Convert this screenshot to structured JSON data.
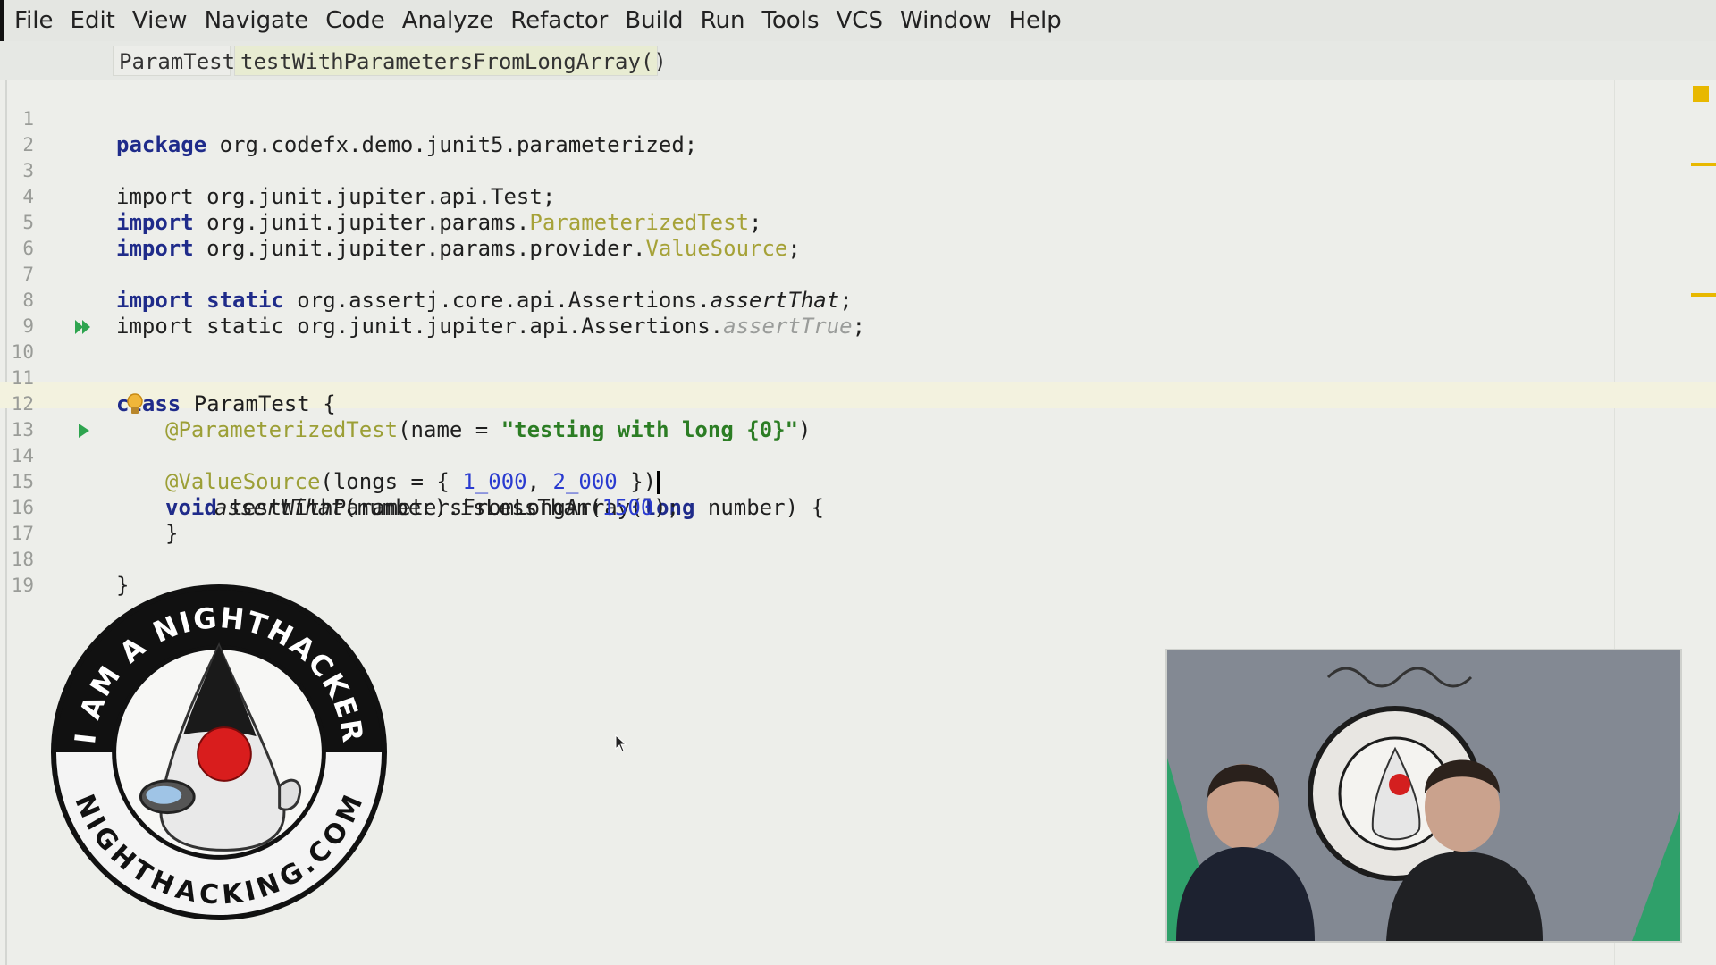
{
  "menubar": {
    "items": [
      "File",
      "Edit",
      "View",
      "Navigate",
      "Code",
      "Analyze",
      "Refactor",
      "Build",
      "Run",
      "Tools",
      "VCS",
      "Window",
      "Help"
    ]
  },
  "breadcrumbs": {
    "class_name": "ParamTest",
    "method_name": "testWithParametersFromLongArray()"
  },
  "editor": {
    "line_numbers": [
      "1",
      "2",
      "3",
      "4",
      "5",
      "6",
      "7",
      "8",
      "9",
      "10",
      "11",
      "12",
      "13",
      "14",
      "15",
      "16",
      "17",
      "18",
      "19"
    ],
    "code": {
      "l1": {
        "kw": "package",
        "rest": " org.codefx.demo.junit5.parameterized;"
      },
      "l3": {
        "text": "import org.junit.jupiter.api.Test;"
      },
      "l4": {
        "kw": "import",
        "pkg": " org.junit.jupiter.params.",
        "cls": "ParameterizedTest",
        "end": ";"
      },
      "l5": {
        "kw": "import",
        "pkg": " org.junit.jupiter.params.provider.",
        "cls": "ValueSource",
        "end": ";"
      },
      "l7": {
        "kw1": "import",
        "kw2": "static",
        "pkg": " org.assertj.core.api.Assertions.",
        "method": "assertThat",
        "end": ";"
      },
      "l8": {
        "kw1": "import",
        "kw2": "static",
        "pkg": " org.junit.jupiter.api.Assertions.",
        "method": "assertTrue",
        "end": ";"
      },
      "l10": {
        "kw": "class",
        "rest": " ParamTest {"
      },
      "l12": {
        "ann": "@ParameterizedTest",
        "open": "(name = ",
        "str": "\"testing with long {0}\"",
        "close": ")"
      },
      "l13": {
        "ann": "@ValueSource",
        "open": "(longs = { ",
        "n1": "1_000",
        "sep": ", ",
        "n2": "2_000",
        "close": " })"
      },
      "l14": {
        "kw": "void",
        "name": " testWithParametersFromLongArray(",
        "kw2": "long",
        "rest": " number) {"
      },
      "l15": {
        "method": "assertThat",
        "mid": "(number).isLessThan(",
        "num": "1500",
        "end": ");"
      },
      "l16": {
        "text": "}"
      },
      "l18": {
        "text": "}"
      }
    }
  },
  "logo": {
    "top_text": "I AM A NIGHTHACKER",
    "bottom_text": "NIGHTHACKING.COM"
  },
  "colors": {
    "keyword": "#1f2b8a",
    "annotation": "#9c9f36",
    "string": "#2c7d24",
    "number": "#2a3bd0",
    "unused_import": "#9a9c9a",
    "current_line": "#f3f2df",
    "marker": "#e8b800"
  },
  "icons": {
    "class_run": "run-all-icon",
    "method_run": "run-icon",
    "intention": "lightbulb-icon",
    "pointer": "mouse-cursor-icon"
  }
}
